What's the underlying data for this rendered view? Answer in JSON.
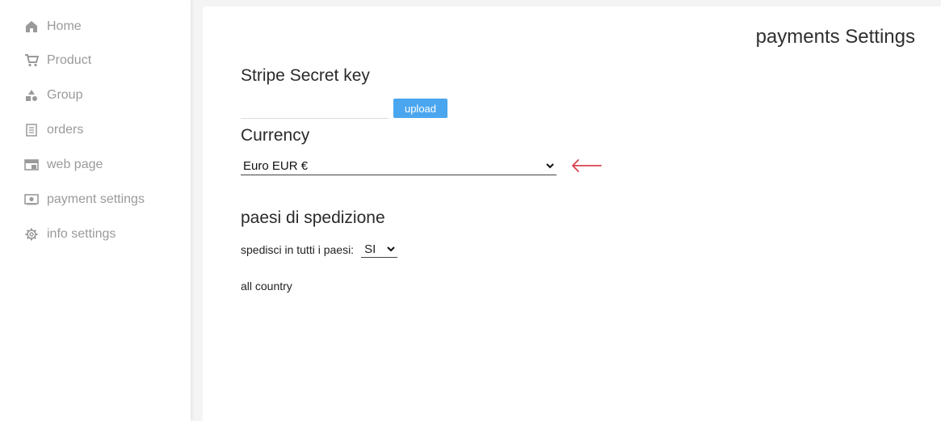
{
  "sidebar": {
    "items": [
      {
        "label": "Home",
        "icon": "home-icon"
      },
      {
        "label": "Product",
        "icon": "cart-icon"
      },
      {
        "label": "Group",
        "icon": "shapes-icon"
      },
      {
        "label": "orders",
        "icon": "list-icon"
      },
      {
        "label": "web page",
        "icon": "webpage-icon"
      },
      {
        "label": "payment settings",
        "icon": "money-icon"
      },
      {
        "label": "info settings",
        "icon": "gear-icon"
      }
    ]
  },
  "main": {
    "title": "payments Settings",
    "stripe": {
      "heading": "Stripe Secret key",
      "input_value": "",
      "upload_label": "upload"
    },
    "currency": {
      "heading": "Currency",
      "selected": "Euro EUR €"
    },
    "shipping": {
      "heading": "paesi di spedizione",
      "all_countries_label": "spedisci in tutti i paesi:",
      "all_countries_value": "SI",
      "countries_text": "all country"
    }
  },
  "colors": {
    "sidebar_text": "#9a9a9a",
    "button_blue": "#4aa6ef",
    "annotation_red": "#d9434f",
    "background": "#f4f4f4"
  }
}
